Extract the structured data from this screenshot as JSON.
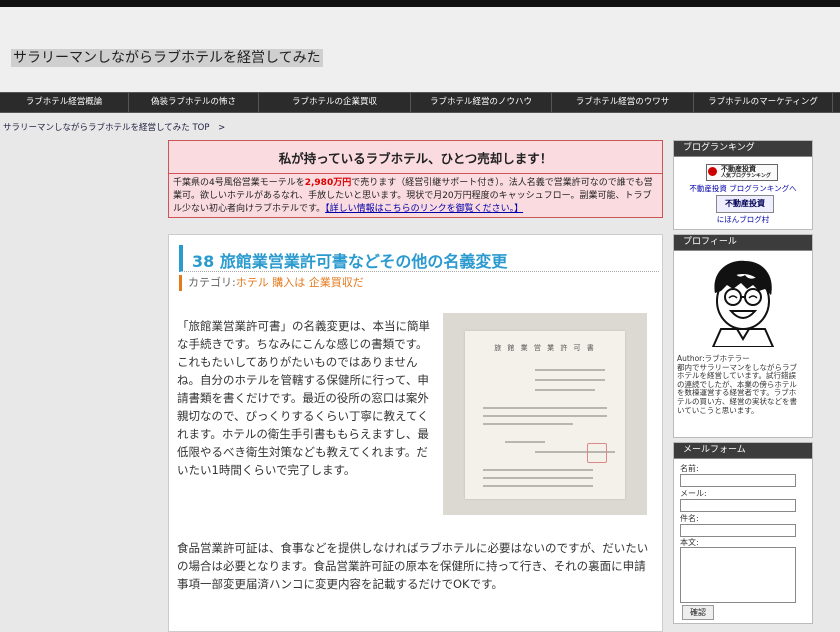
{
  "site": {
    "title": "サラリーマンしながらラブホテルを経営してみた"
  },
  "nav": {
    "items": [
      "ラブホテル経営概論",
      "偽装ラブホテルの怖さ",
      "ラブホテルの企業買収",
      "ラブホテル経営のノウハウ",
      "ラブホテル経営のウワサ",
      "ラブホテルのマーケティング"
    ]
  },
  "breadcrumb": {
    "text": "サラリーマンしながらラブホテルを経営してみた TOP",
    "sep": ">"
  },
  "notice": {
    "title": "私が持っているラブホテル、ひとつ売却します！",
    "body_pre": "千葉県の4号風俗営業モーテルを",
    "price": "2,980万円",
    "body_post": "で売ります（経営引継サポート付き）。法人名義で営業許可なので誰でも営業可。欲しいホテルがあるなれ、手放したいと思います。現状で月20万円程度のキャッシュフロー。副業可能、トラブル少ない初心者向けラブホテルです。",
    "link": "【詳しい情報はこちらのリンクを御覧ください。】"
  },
  "article": {
    "title": "38 旅館業営業許可書などその他の名義変更",
    "category_label": "カテゴリ:",
    "category_link": "ホテル 購入は 企業買収だ",
    "para1": "「旅館業営業許可書」の名義変更は、本当に簡単な手続きです。ちなみにこんな感じの書類です。これもたいしてありがたいものではありませんね。自分のホテルを管轄する保健所に行って、申請書類を書くだけです。最近の役所の窓口は案外親切なので、びっくりするくらい丁寧に教えてくれます。ホテルの衛生手引書ももらえますし、最低限やるべき衛生対策なども教えてくれます。だいたい1時間くらいで完了します。",
    "para2": "食品営業許可証は、食事などを提供しなければラブホテルに必要はないのですが、だいたいの場合は必要となります。食品営業許可証の原本を保健所に持って行き、それの裏面に申請事項一部変更届済ハンコに変更内容を記載するだけでOKです。",
    "photo_doc_title": "旅 館 業 営 業 許 可 書"
  },
  "sidebar": {
    "ranking": {
      "heading": "ブログランキング",
      "banner_line1": "不動産投資",
      "banner_line2": "人気ブログランキング",
      "link1": "不動産投資 ブログランキングへ",
      "banner2": "不動産投資",
      "link2": "にほんブログ村"
    },
    "profile": {
      "heading": "プロフィール",
      "text": "Author:ラブホテラー\n都内でサラリーマンをしながらラブホテルを経営しています。試行錯誤の連続でしたが、本業の傍らホテルを数棟運営する経営者です。ラブホテルの買い方、経営の実状などを書いていこうと思います。"
    },
    "mailform": {
      "heading": "メールフォーム",
      "name_label": "名前:",
      "mail_label": "メール:",
      "subject_label": "件名:",
      "body_label": "本文:",
      "submit": "確認"
    }
  },
  "colors": {
    "accent": "#2a9acf",
    "category": "#e47a1e",
    "notice_bg": "#fadbe0",
    "nav_bg": "#2b2b2b"
  }
}
